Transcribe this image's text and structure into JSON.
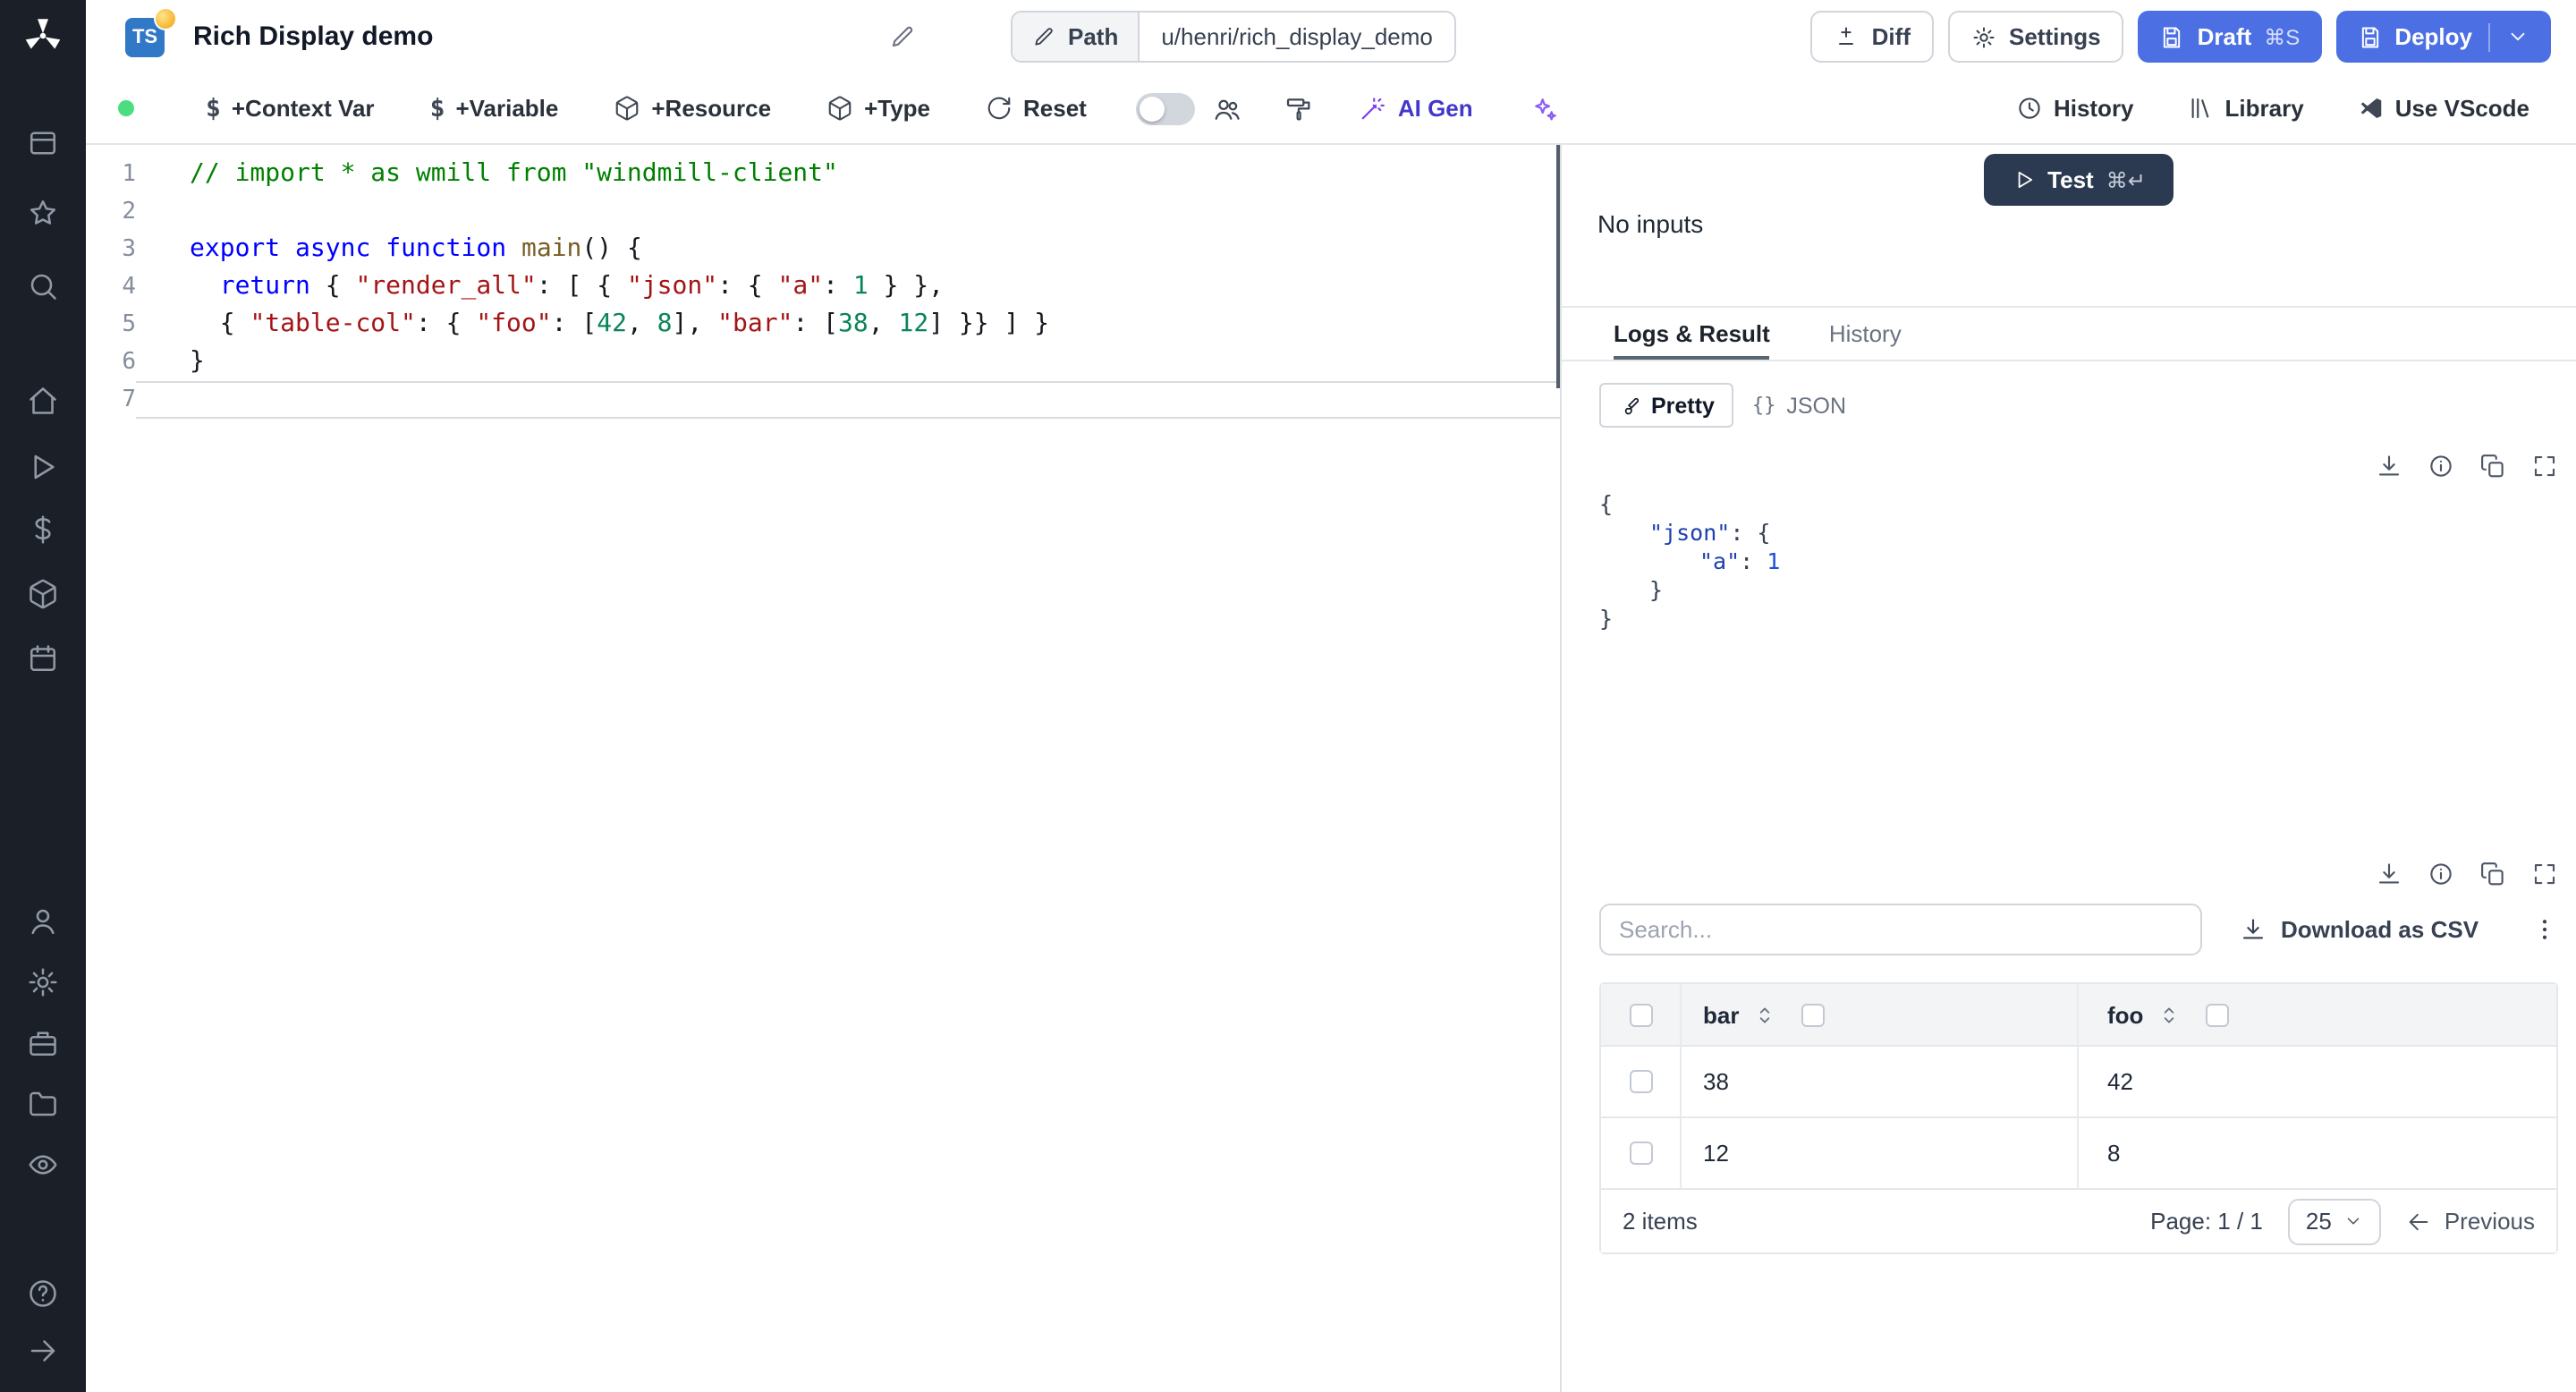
{
  "header": {
    "language_badge": "TS",
    "title": "Rich Display demo",
    "path_button": "Path",
    "path_value": "u/henri/rich_display_demo",
    "diff_button": "Diff",
    "settings_button": "Settings",
    "draft_button": "Draft",
    "draft_shortcut": "⌘S",
    "deploy_button": "Deploy"
  },
  "toolbar": {
    "add_context_var": "+Context Var",
    "add_variable": "+Variable",
    "add_resource": "+Resource",
    "add_type": "+Type",
    "reset": "Reset",
    "ai_gen": "AI Gen",
    "history": "History",
    "library": "Library",
    "use_vscode": "Use VScode"
  },
  "editor": {
    "lines": [
      {
        "num": "1",
        "tokens": [
          {
            "t": "// import * as wmill from \"windmill-client\"",
            "c": "comment"
          }
        ]
      },
      {
        "num": "2",
        "tokens": []
      },
      {
        "num": "3",
        "tokens": [
          {
            "t": "export",
            "c": "kw"
          },
          {
            "t": " ",
            "c": "plain"
          },
          {
            "t": "async",
            "c": "kw"
          },
          {
            "t": " ",
            "c": "plain"
          },
          {
            "t": "function",
            "c": "kw"
          },
          {
            "t": " ",
            "c": "plain"
          },
          {
            "t": "main",
            "c": "fn"
          },
          {
            "t": "() {",
            "c": "plain"
          }
        ]
      },
      {
        "num": "4",
        "tokens": [
          {
            "t": "  ",
            "c": "plain"
          },
          {
            "t": "return",
            "c": "kw"
          },
          {
            "t": " { ",
            "c": "plain"
          },
          {
            "t": "\"render_all\"",
            "c": "str"
          },
          {
            "t": ": [ { ",
            "c": "plain"
          },
          {
            "t": "\"json\"",
            "c": "str"
          },
          {
            "t": ": { ",
            "c": "plain"
          },
          {
            "t": "\"a\"",
            "c": "str"
          },
          {
            "t": ": ",
            "c": "plain"
          },
          {
            "t": "1",
            "c": "num"
          },
          {
            "t": " } },",
            "c": "plain"
          }
        ]
      },
      {
        "num": "5",
        "tokens": [
          {
            "t": "  { ",
            "c": "plain"
          },
          {
            "t": "\"table-col\"",
            "c": "str"
          },
          {
            "t": ": { ",
            "c": "plain"
          },
          {
            "t": "\"foo\"",
            "c": "str"
          },
          {
            "t": ": [",
            "c": "plain"
          },
          {
            "t": "42",
            "c": "num"
          },
          {
            "t": ", ",
            "c": "plain"
          },
          {
            "t": "8",
            "c": "num"
          },
          {
            "t": "], ",
            "c": "plain"
          },
          {
            "t": "\"bar\"",
            "c": "str"
          },
          {
            "t": ": [",
            "c": "plain"
          },
          {
            "t": "38",
            "c": "num"
          },
          {
            "t": ", ",
            "c": "plain"
          },
          {
            "t": "12",
            "c": "num"
          },
          {
            "t": "] }} ] }",
            "c": "plain"
          }
        ]
      },
      {
        "num": "6",
        "tokens": [
          {
            "t": "}",
            "c": "plain"
          }
        ]
      },
      {
        "num": "7",
        "tokens": [],
        "current": true
      }
    ]
  },
  "run_panel": {
    "test_button": "Test",
    "test_shortcut": "⌘↵",
    "no_inputs": "No inputs",
    "tab_logs": "Logs & Result",
    "tab_history": "History",
    "view_pretty": "Pretty",
    "view_json": "JSON",
    "json_glyph": "{}"
  },
  "result": {
    "lines": [
      {
        "indent": 0,
        "tokens": [
          {
            "t": "{",
            "c": "plain"
          }
        ]
      },
      {
        "indent": 1,
        "tokens": [
          {
            "t": "\"json\"",
            "c": "key"
          },
          {
            "t": ": {",
            "c": "plain"
          }
        ]
      },
      {
        "indent": 2,
        "tokens": [
          {
            "t": "\"a\"",
            "c": "key"
          },
          {
            "t": ": ",
            "c": "plain"
          },
          {
            "t": "1",
            "c": "val"
          }
        ]
      },
      {
        "indent": 1,
        "tokens": [
          {
            "t": "}",
            "c": "plain"
          }
        ]
      },
      {
        "indent": 0,
        "tokens": [
          {
            "t": "}",
            "c": "plain"
          }
        ]
      }
    ]
  },
  "table": {
    "search_placeholder": "Search...",
    "download_csv": "Download as CSV",
    "columns": [
      "bar",
      "foo"
    ],
    "rows": [
      [
        "38",
        "42"
      ],
      [
        "12",
        "8"
      ]
    ],
    "items_count": "2 items",
    "page_label": "Page: 1 / 1",
    "page_size": "25",
    "previous_button": "Previous"
  },
  "icon_names": [
    "windmill-logo",
    "apps-icon",
    "favorites-icon",
    "search-icon",
    "home-icon",
    "runs-icon",
    "variables-icon",
    "resources-icon",
    "schedules-icon",
    "users-icon",
    "settings-icon",
    "workers-icon",
    "folders-icon",
    "audit-logs-icon",
    "help-icon",
    "expand-sidebar-icon",
    "pencil-icon",
    "diff-icon",
    "gear-icon",
    "save-icon",
    "chevron-down-icon",
    "dollar-icon",
    "package-icon",
    "reset-icon",
    "multiplayer-icon",
    "format-icon",
    "wand-icon",
    "sparkles-icon",
    "clock-icon",
    "library-icon",
    "vscode-icon",
    "play-icon",
    "download-icon",
    "info-icon",
    "copy-icon",
    "expand-icon",
    "kebab-icon",
    "sort-icon",
    "arrow-left-icon"
  ],
  "colors": {
    "primary_blue": "#4c6fe4",
    "dark_button": "#2b3a50",
    "status_green": "#4ade80",
    "ts_badge_blue": "#3178c6",
    "ai_accent": "#7c3aed",
    "sidebar_bg": "#1b1f27"
  }
}
